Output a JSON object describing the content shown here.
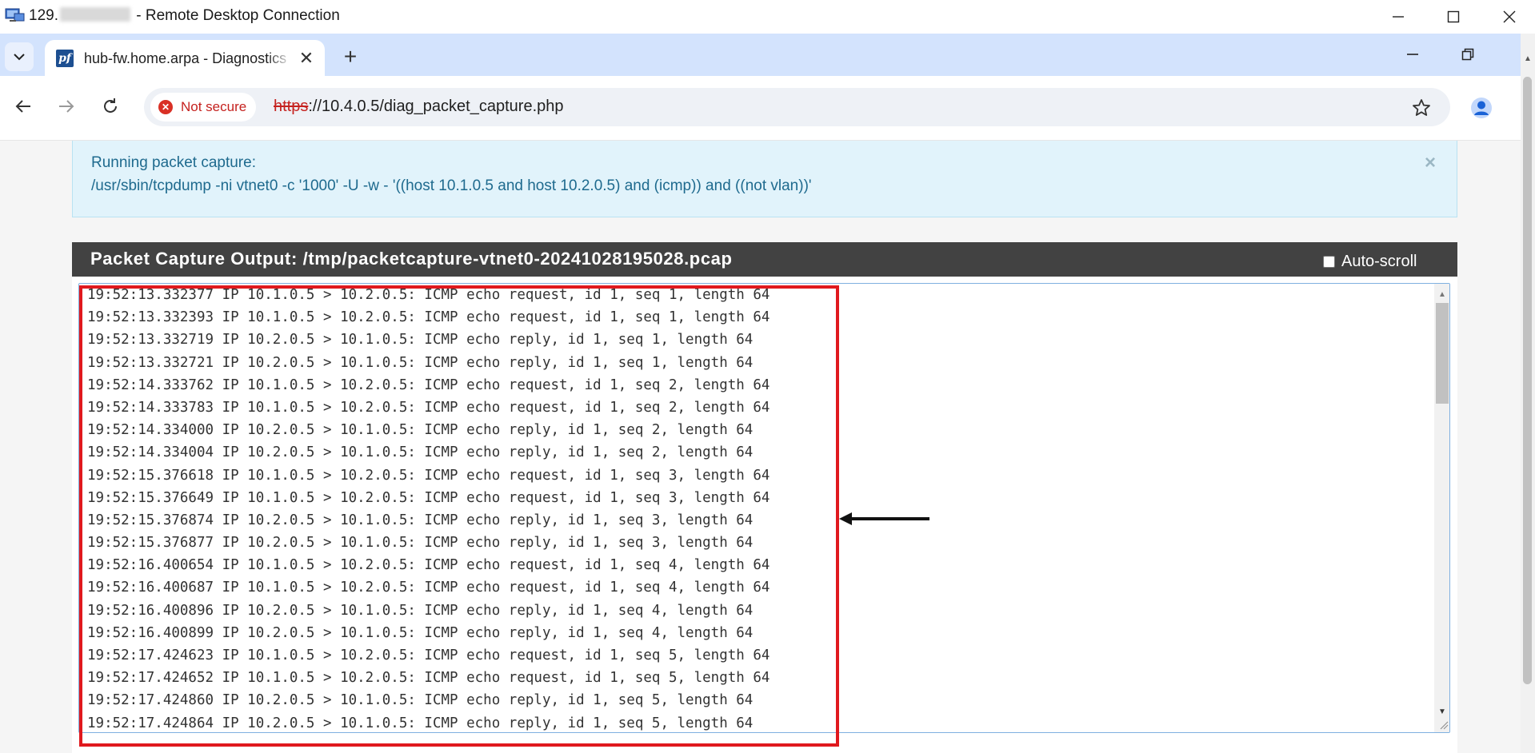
{
  "rdp": {
    "title_prefix": "129.",
    "title_suffix": "- Remote Desktop Connection",
    "minimize": "—",
    "maximize": "☐",
    "close": "✕"
  },
  "browser": {
    "tab_title": "hub-fw.home.arpa - Diagnostics",
    "tab_favicon": "pf",
    "tab_close": "✕",
    "new_tab": "+",
    "security_label": "Not secure",
    "url_scheme": "https",
    "url_rest": "://10.4.0.5/diag_packet_capture.php"
  },
  "alert": {
    "line1": "Running packet capture:",
    "line2": "/usr/sbin/tcpdump -ni vtnet0 -c '1000' -U -w - '((host 10.1.0.5 and host 10.2.0.5) and (icmp)) and ((not vlan))'",
    "close": "×"
  },
  "panel": {
    "title": "Packet Capture Output: /tmp/packetcapture-vtnet0-20241028195028.pcap",
    "autoscroll_label": "Auto-scroll",
    "autoscroll_checked": false
  },
  "output_lines": [
    "19:52:13.332377 IP 10.1.0.5 > 10.2.0.5: ICMP echo request, id 1, seq 1, length 64",
    "19:52:13.332393 IP 10.1.0.5 > 10.2.0.5: ICMP echo request, id 1, seq 1, length 64",
    "19:52:13.332719 IP 10.2.0.5 > 10.1.0.5: ICMP echo reply, id 1, seq 1, length 64",
    "19:52:13.332721 IP 10.2.0.5 > 10.1.0.5: ICMP echo reply, id 1, seq 1, length 64",
    "19:52:14.333762 IP 10.1.0.5 > 10.2.0.5: ICMP echo request, id 1, seq 2, length 64",
    "19:52:14.333783 IP 10.1.0.5 > 10.2.0.5: ICMP echo request, id 1, seq 2, length 64",
    "19:52:14.334000 IP 10.2.0.5 > 10.1.0.5: ICMP echo reply, id 1, seq 2, length 64",
    "19:52:14.334004 IP 10.2.0.5 > 10.1.0.5: ICMP echo reply, id 1, seq 2, length 64",
    "19:52:15.376618 IP 10.1.0.5 > 10.2.0.5: ICMP echo request, id 1, seq 3, length 64",
    "19:52:15.376649 IP 10.1.0.5 > 10.2.0.5: ICMP echo request, id 1, seq 3, length 64",
    "19:52:15.376874 IP 10.2.0.5 > 10.1.0.5: ICMP echo reply, id 1, seq 3, length 64",
    "19:52:15.376877 IP 10.2.0.5 > 10.1.0.5: ICMP echo reply, id 1, seq 3, length 64",
    "19:52:16.400654 IP 10.1.0.5 > 10.2.0.5: ICMP echo request, id 1, seq 4, length 64",
    "19:52:16.400687 IP 10.1.0.5 > 10.2.0.5: ICMP echo request, id 1, seq 4, length 64",
    "19:52:16.400896 IP 10.2.0.5 > 10.1.0.5: ICMP echo reply, id 1, seq 4, length 64",
    "19:52:16.400899 IP 10.2.0.5 > 10.1.0.5: ICMP echo reply, id 1, seq 4, length 64",
    "19:52:17.424623 IP 10.1.0.5 > 10.2.0.5: ICMP echo request, id 1, seq 5, length 64",
    "19:52:17.424652 IP 10.1.0.5 > 10.2.0.5: ICMP echo request, id 1, seq 5, length 64",
    "19:52:17.424860 IP 10.2.0.5 > 10.1.0.5: ICMP echo reply, id 1, seq 5, length 64",
    "19:52:17.424864 IP 10.2.0.5 > 10.1.0.5: ICMP echo reply, id 1, seq 5, length 64"
  ],
  "colors": {
    "alert_bg": "#e1f3fb",
    "alert_text": "#1e6a8e",
    "panel_header": "#424242",
    "highlight": "#e0191e",
    "not_secure": "#c5221f"
  },
  "icons": {
    "rdp": "remote-desktop-icon",
    "back": "back-arrow-icon",
    "forward": "forward-arrow-icon",
    "reload": "reload-icon",
    "star": "star-icon",
    "profile": "profile-icon"
  }
}
